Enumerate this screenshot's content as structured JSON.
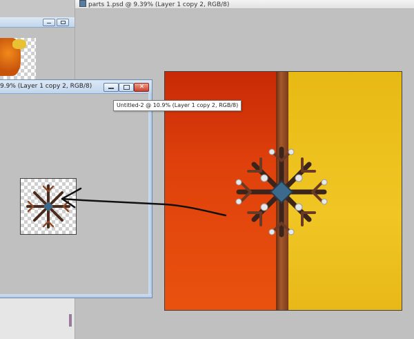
{
  "main_window": {
    "title": "parts 1.psd @ 9.39% (Layer 1 copy 2, RGB/8)",
    "icon": "photoshop-doc-icon",
    "canvas": {
      "left_color": "#d8380a",
      "stripe_color": "#8a4420",
      "right_color": "#ecc020"
    }
  },
  "second_window": {
    "title": "9.9% (Layer 1 copy 2, RGB/8)",
    "buttons": [
      "minimize-icon",
      "maximize-icon",
      "close-icon"
    ],
    "close_label": "✕"
  },
  "tooltip": {
    "text": "Untitled-2 @ 10.9% (Layer 1 copy 2, RGB/8)"
  },
  "top_left_window": {
    "buttons": [
      "minimize-icon",
      "maximize-icon"
    ]
  }
}
